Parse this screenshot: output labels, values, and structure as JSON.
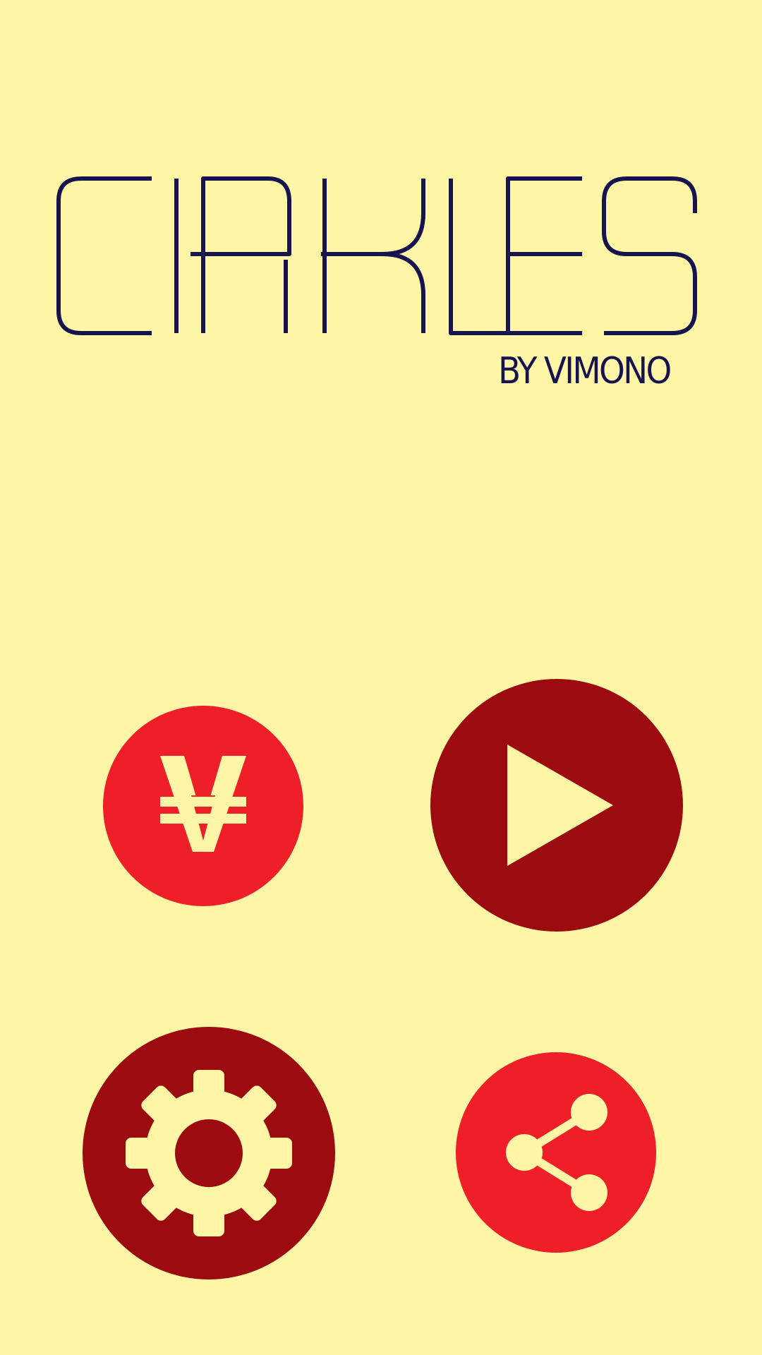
{
  "app": {
    "title": "CIRKLES",
    "subtitle": "BY VIMONO"
  },
  "colors": {
    "background": "#FEF6A6",
    "title_ink": "#16134E",
    "primary_red": "#EE1F28",
    "dark_red": "#9C0B10",
    "icon_fill": "#FEF6A6"
  },
  "menu": {
    "buttons": [
      {
        "id": "store",
        "icon": "currency-icon",
        "style": "primary_red"
      },
      {
        "id": "play",
        "icon": "play-icon",
        "style": "dark_red"
      },
      {
        "id": "settings",
        "icon": "gear-icon",
        "style": "dark_red"
      },
      {
        "id": "share",
        "icon": "share-icon",
        "style": "primary_red"
      }
    ]
  }
}
